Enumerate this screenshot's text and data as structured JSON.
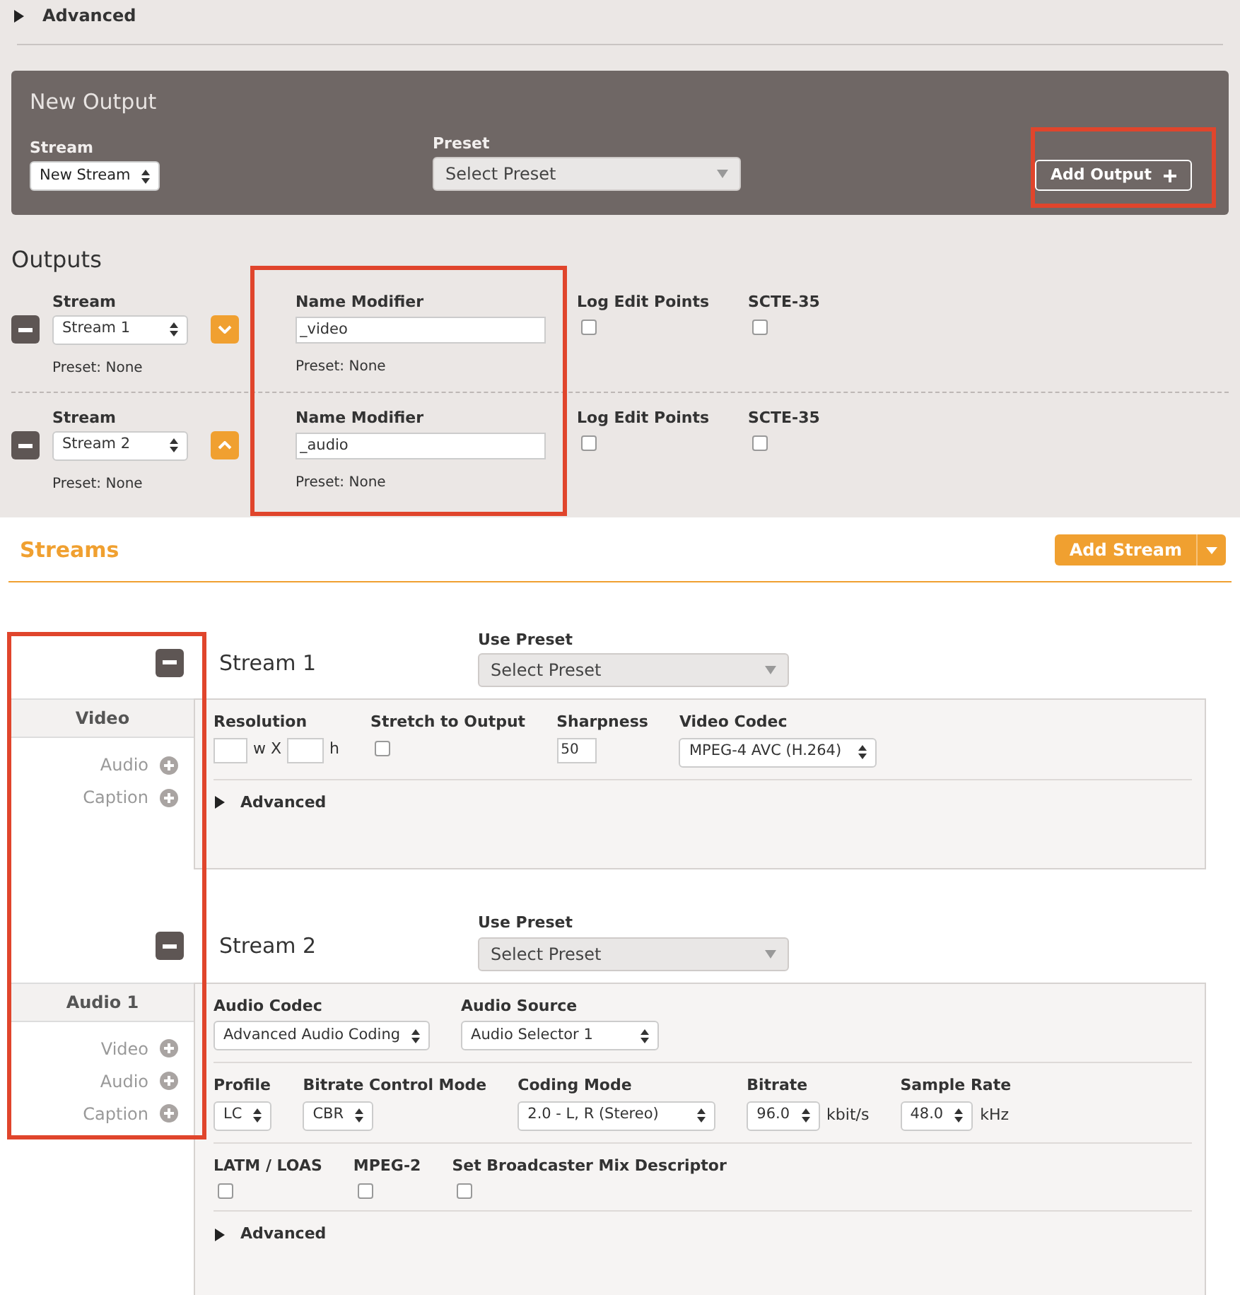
{
  "advanced": {
    "label": "Advanced",
    "expanded": false
  },
  "new_output": {
    "title": "New Output",
    "stream": {
      "label": "Stream",
      "value": "New Stream"
    },
    "preset": {
      "label": "Preset",
      "value": "Select Preset"
    },
    "add_button": {
      "label": "Add Output",
      "highlighted": true
    }
  },
  "outputs": {
    "title": "Outputs",
    "name_column_highlighted": true,
    "rows": [
      {
        "stream_label": "Stream",
        "stream": "Stream 1",
        "preset": "Preset: None",
        "move_up": false,
        "name_label": "Name Modifier",
        "name": "_video",
        "name_preset": "Preset: None",
        "log_label": "Log Edit Points",
        "log_checked": false,
        "scte_label": "SCTE-35",
        "scte_checked": false
      },
      {
        "stream_label": "Stream",
        "stream": "Stream 2",
        "preset": "Preset: None",
        "move_up": true,
        "name_label": "Name Modifier",
        "name": "_audio",
        "name_preset": "Preset: None",
        "log_label": "Log Edit Points",
        "log_checked": false,
        "scte_label": "SCTE-35",
        "scte_checked": false
      }
    ]
  },
  "streams": {
    "title": "Streams",
    "add_button": "Add Stream",
    "sidebar_highlighted": true,
    "items": [
      {
        "title": "Stream 1",
        "preset_label": "Use Preset",
        "preset": "Select Preset",
        "tab": "Video",
        "add_links": [
          "Audio",
          "Caption"
        ],
        "rows": [
          [
            {
              "kind": "resolution",
              "label": "Resolution",
              "sep": "w X",
              "suffix": "h"
            },
            {
              "kind": "checkbox",
              "label": "Stretch to Output",
              "checked": false
            },
            {
              "kind": "text",
              "label": "Sharpness",
              "value": "50"
            },
            {
              "kind": "select",
              "label": "Video Codec",
              "value": "MPEG-4 AVC (H.264)"
            }
          ]
        ],
        "advanced": {
          "label": "Advanced",
          "expanded": false
        }
      },
      {
        "title": "Stream 2",
        "preset_label": "Use Preset",
        "preset": "Select Preset",
        "tab": "Audio 1",
        "add_links": [
          "Video",
          "Audio",
          "Caption"
        ],
        "rows": [
          [
            {
              "kind": "select",
              "label": "Audio Codec",
              "value": "Advanced Audio Coding"
            },
            {
              "kind": "select",
              "label": "Audio Source",
              "value": "Audio Selector 1"
            }
          ],
          [
            {
              "kind": "select",
              "label": "Profile",
              "value": "LC"
            },
            {
              "kind": "select",
              "label": "Bitrate Control Mode",
              "value": "CBR"
            },
            {
              "kind": "select",
              "label": "Coding Mode",
              "value": "2.0 - L, R (Stereo)"
            },
            {
              "kind": "select",
              "label": "Bitrate",
              "value": "96.0",
              "unit": "kbit/s"
            },
            {
              "kind": "select",
              "label": "Sample Rate",
              "value": "48.0",
              "unit": "kHz"
            }
          ],
          [
            {
              "kind": "checkbox",
              "label": "LATM / LOAS",
              "checked": false
            },
            {
              "kind": "checkbox",
              "label": "MPEG-2",
              "checked": false
            },
            {
              "kind": "checkbox",
              "label": "Set Broadcaster Mix Descriptor",
              "checked": false
            }
          ]
        ],
        "advanced": {
          "label": "Advanced",
          "expanded": false
        }
      }
    ]
  }
}
